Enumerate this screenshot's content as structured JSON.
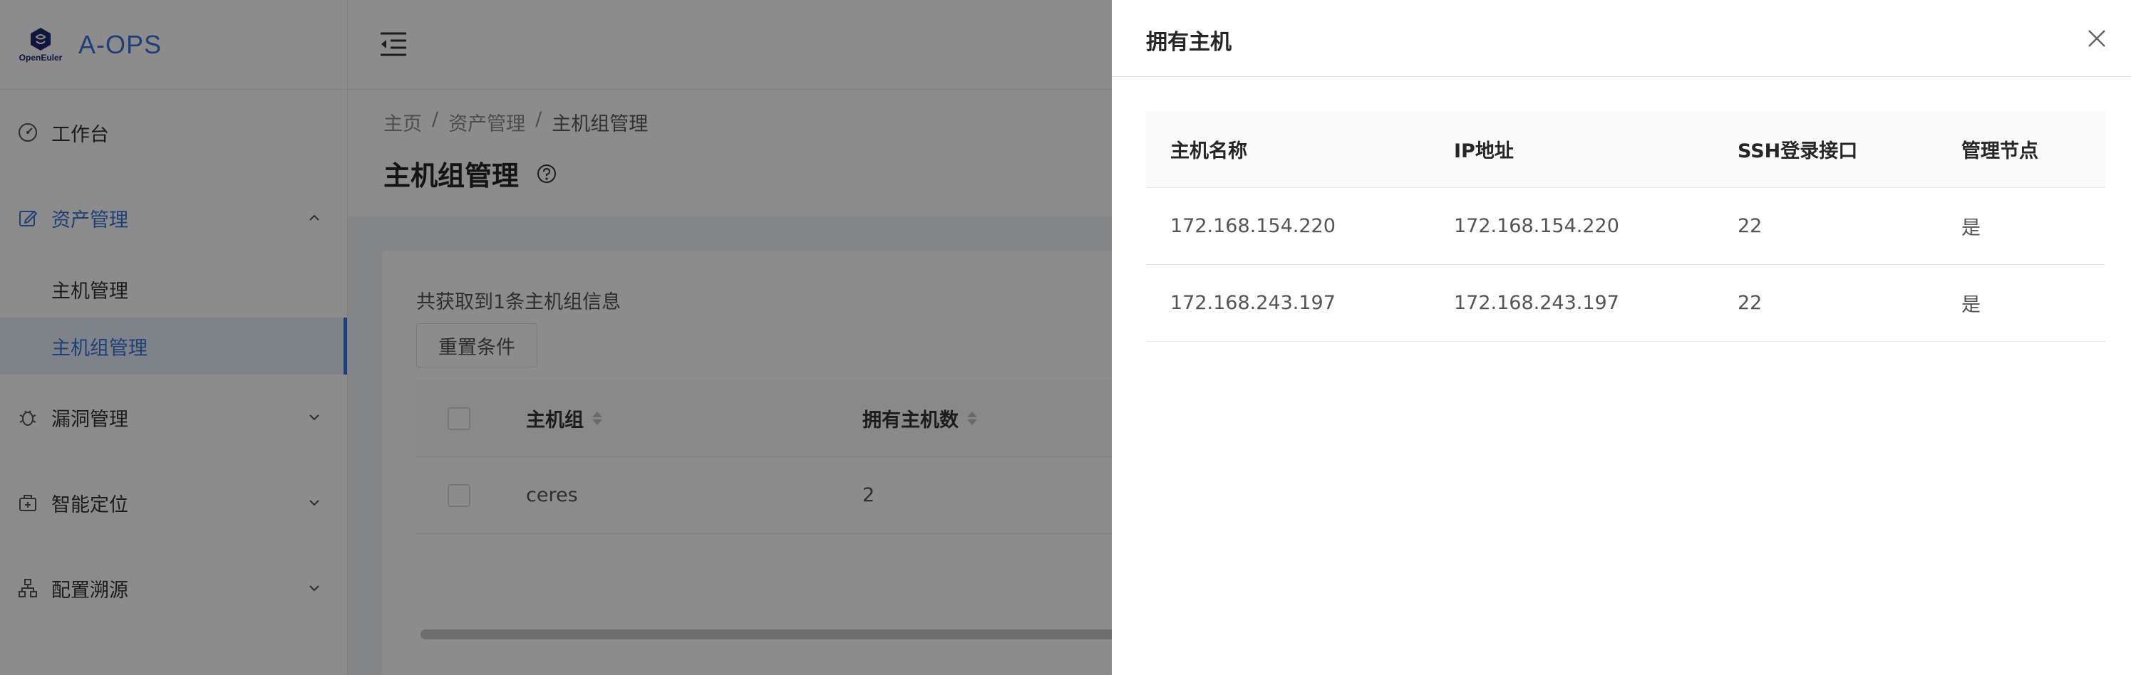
{
  "app": {
    "logo_sub": "OpenEuler",
    "title": "A-OPS"
  },
  "sidebar": {
    "items": [
      {
        "label": "工作台",
        "icon": "dashboard-icon"
      },
      {
        "label": "资产管理",
        "icon": "edit-icon",
        "expanded": true
      },
      {
        "label": "漏洞管理",
        "icon": "bug-icon"
      },
      {
        "label": "智能定位",
        "icon": "locate-icon"
      },
      {
        "label": "配置溯源",
        "icon": "cluster-icon"
      }
    ],
    "sub_items": [
      {
        "label": "主机管理"
      },
      {
        "label": "主机组管理",
        "selected": true
      }
    ]
  },
  "breadcrumb": {
    "home": "主页",
    "sep": "/",
    "section": "资产管理",
    "current": "主机组管理"
  },
  "page_title": "主机组管理",
  "card": {
    "info": "共获取到1条主机组信息",
    "reset_label": "重置条件",
    "columns": {
      "group": "主机组",
      "host_count": "拥有主机数"
    },
    "rows": [
      {
        "group": "ceres",
        "host_count": "2"
      }
    ]
  },
  "drawer": {
    "title": "拥有主机",
    "columns": {
      "name": "主机名称",
      "ip": "IP地址",
      "ssh": "SSH登录接口",
      "manager": "管理节点"
    },
    "rows": [
      {
        "name": "172.168.154.220",
        "ip": "172.168.154.220",
        "ssh": "22",
        "manager": "是"
      },
      {
        "name": "172.168.243.197",
        "ip": "172.168.243.197",
        "ssh": "22",
        "manager": "是"
      }
    ]
  },
  "colors": {
    "accent": "#3b73d8",
    "mask": "rgba(0,0,0,0.45)"
  }
}
